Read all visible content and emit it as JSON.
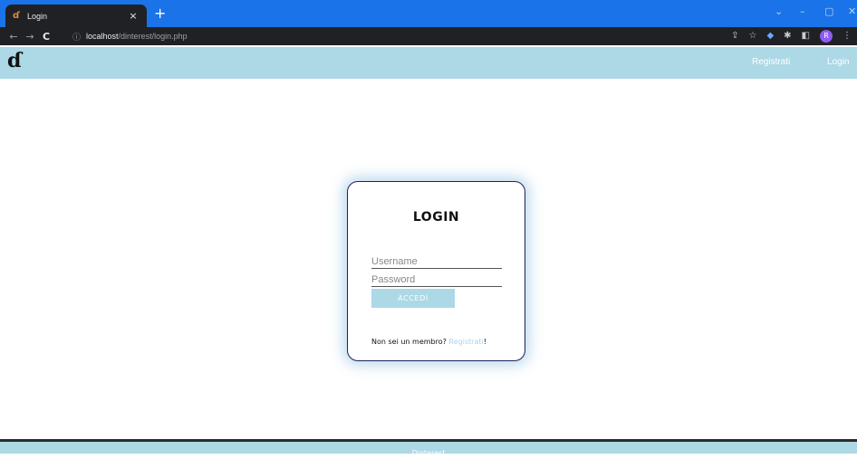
{
  "browser": {
    "tab_title": "Login",
    "tab_favicon": "ɗ",
    "tab_close": "×",
    "new_tab": "+",
    "window_controls": {
      "dropdown": "⌄",
      "minimize": "–",
      "maximize": "▢",
      "close": "✕"
    },
    "nav": {
      "back": "←",
      "forward": "→",
      "reload": "C"
    },
    "url_info_icon": "ⓘ",
    "url_host": "localhost",
    "url_path": "/dinterest/login.php",
    "toolbar_icons": [
      "share-icon",
      "bookmark-star-icon",
      "extension-icon",
      "puzzle-icon",
      "sidepanel-icon",
      "profile-avatar-icon",
      "menu-icon"
    ],
    "profile_initial": "R"
  },
  "site": {
    "logo": "ɗ",
    "nav": {
      "register": "Registrati",
      "login": "Login"
    }
  },
  "login": {
    "title": "LOGIN",
    "username_placeholder": "Username",
    "password_placeholder": "Password",
    "submit_label": "ACCEDI",
    "signup_prompt": "Non sei un membro?",
    "signup_link": "Registrati",
    "signup_suffix": "!"
  },
  "footer": {
    "text": "Dinterest"
  },
  "colors": {
    "header_bg": "#add8e6",
    "tabstrip_bg": "#1a73e8",
    "toolbar_bg": "#202124",
    "card_border": "#202060"
  }
}
